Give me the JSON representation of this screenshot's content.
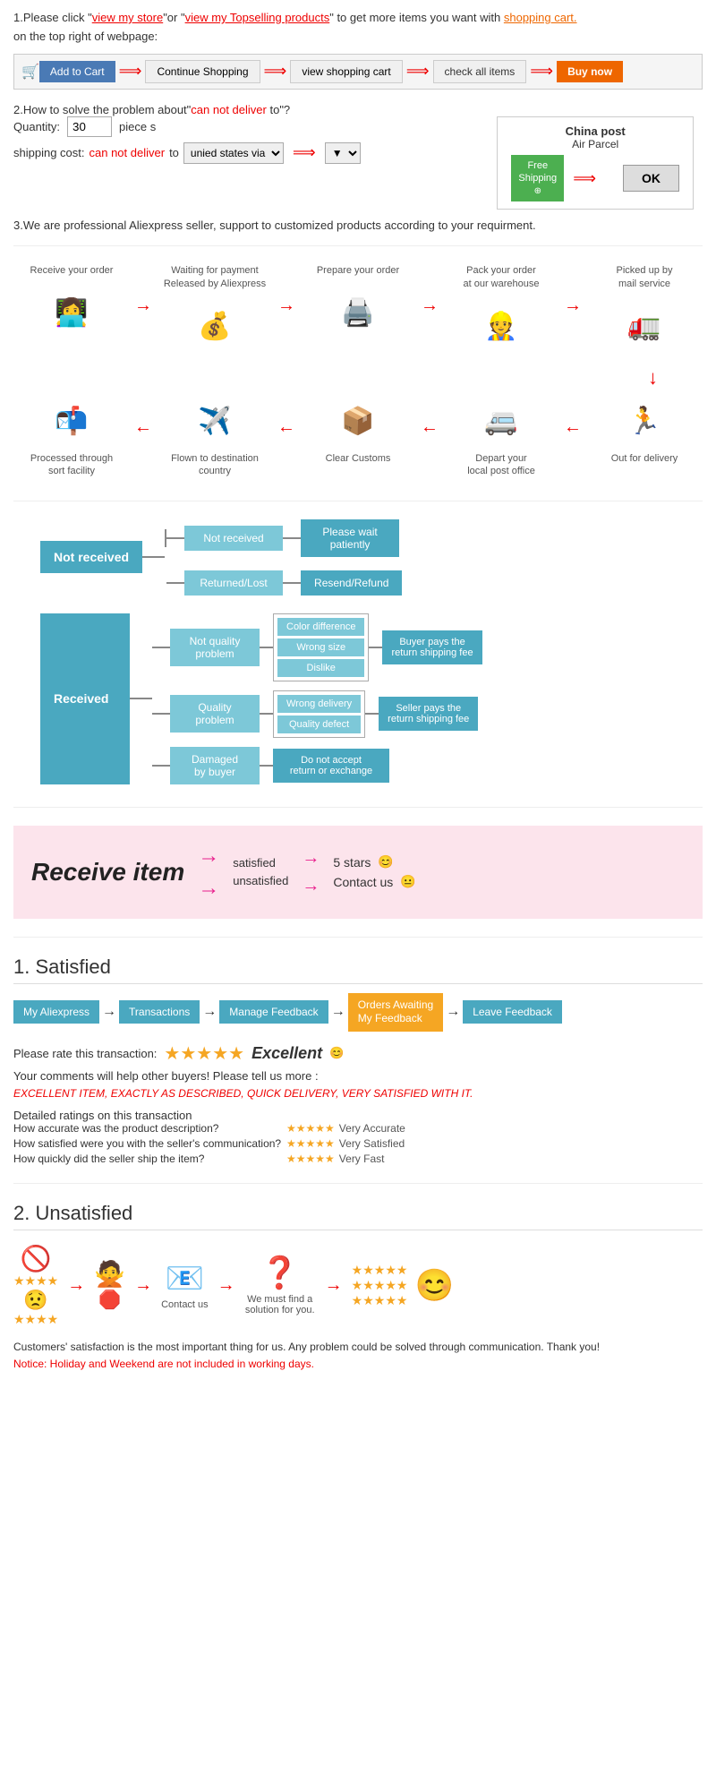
{
  "section1": {
    "intro": "1.Please click ",
    "view_store": "view my store",
    "or": "or \"",
    "view_topselling": "view my Topselling products",
    "to_get": "\" to get more items you want with shopping cart.",
    "on_top": "on the top right of webpage:",
    "steps": [
      {
        "label": "Add to Cart",
        "icon": "🛒"
      },
      {
        "label": "Continue Shopping"
      },
      {
        "label": "view shopping cart"
      },
      {
        "label": "check all items"
      },
      {
        "label": "Buy now",
        "highlight": true
      }
    ]
  },
  "section2": {
    "title": "2.How to solve the problem about\"can not deliver to\"?",
    "cant_deliver": "can not deliver",
    "quantity_label": "Quantity:",
    "quantity_value": "30",
    "piece_label": "piece s",
    "shipping_label": "shipping cost:",
    "shipping_cant": "can not deliver",
    "shipping_to": " to ",
    "shipping_via": "unied states via",
    "china_post": "China post",
    "air_parcel": "Air Parcel",
    "free_shipping": "Free\nShipping",
    "ok_label": "OK"
  },
  "section3": {
    "text": "3.We are professional Aliexpress seller, support to customized products according to your requirment."
  },
  "order_flow": {
    "top": [
      {
        "label": "Receive your order",
        "icon": "👩‍💻"
      },
      {
        "label": "Waiting for payment\nReleased by Aliexpress",
        "icon": "💰"
      },
      {
        "label": "Prepare your order",
        "icon": "🖨️"
      },
      {
        "label": "Pack your order\nat our warehouse",
        "icon": "👷"
      },
      {
        "label": "Picked up by\nmail service",
        "icon": "🚛"
      }
    ],
    "bottom": [
      {
        "label": "Out for delivery",
        "icon": "🏃"
      },
      {
        "label": "Depart your\nlocal post office",
        "icon": "🚐"
      },
      {
        "label": "Clear Customs",
        "icon": "📦"
      },
      {
        "label": "Flown to destination\ncountry",
        "icon": "✈️"
      },
      {
        "label": "Processed through\nsort facility",
        "icon": "📬"
      }
    ]
  },
  "flowchart": {
    "not_received": {
      "main": "Not received",
      "items": [
        {
          "sub": "Not received",
          "outcome": "Please wait\npatiently"
        },
        {
          "sub": "Returned/Lost",
          "outcome": "Resend/Refund"
        }
      ]
    },
    "received": {
      "main": "Received",
      "items": [
        {
          "sub": "Not quality\nproblem",
          "sub_items": [
            "Color difference",
            "Wrong size",
            "Dislike"
          ],
          "right": "Buyer pays the\nreturn shipping fee"
        },
        {
          "sub": "Quality\nproblem",
          "sub_items": [
            "Wrong delivery",
            "Quality defect"
          ],
          "right": "Seller pays the\nreturn shipping fee"
        },
        {
          "sub": "Damaged\nby buyer",
          "outcome": "Do not accept\nreturn or exchange"
        }
      ]
    }
  },
  "receive_item": {
    "title": "Receive item",
    "outcomes": [
      "satisfied",
      "unsatisfied"
    ],
    "results": [
      "5 stars",
      "Contact us"
    ],
    "emoji_happy": "😊",
    "emoji_neutral": "😐"
  },
  "satisfied": {
    "heading": "1. Satisfied",
    "nav_steps": [
      "My Aliexpress",
      "Transactions",
      "Manage Feedback",
      "Orders Awaiting\nMy Feedback",
      "Leave Feedback"
    ],
    "highlight_index": 3,
    "rate_label": "Please rate this transaction:",
    "stars": "★★★★★",
    "excellent": "Excellent",
    "emoji": "😊",
    "help_text": "Your comments will help other buyers! Please tell us more :",
    "example_comment": "EXCELLENT ITEM, EXACTLY AS DESCRIBED, QUICK DELIVERY, VERY SATISFIED WITH IT.",
    "detailed_label": "Detailed ratings on this transaction",
    "details": [
      {
        "label": "How accurate was the product description?",
        "stars": "★★★★★",
        "value": "Very Accurate"
      },
      {
        "label": "How satisfied were you with the seller's communication?",
        "stars": "★★★★★",
        "value": "Very Satisfied"
      },
      {
        "label": "How quickly did the seller ship the item?",
        "stars": "★★★★★",
        "value": "Very Fast"
      }
    ]
  },
  "unsatisfied": {
    "heading": "2. Unsatisfied",
    "flow_items": [
      {
        "icon": "🚫\n⭐⭐\n⭐⭐",
        "label": ""
      },
      {
        "icon": "🙅\n🛑",
        "label": ""
      },
      {
        "icon": "📧",
        "label": "Contact us"
      },
      {
        "icon": "❓",
        "label": "We must find\na solution for\nyou."
      },
      {
        "stars": [
          "★★★★★",
          "★★★★★",
          "★★★★★"
        ],
        "emoji": "😊",
        "label": ""
      }
    ],
    "notice": "Customers' satisfaction is the most important thing for us. Any problem could be solved through communication. Thank you!",
    "notice_red": "Notice: Holiday and Weekend are not included in working days."
  }
}
